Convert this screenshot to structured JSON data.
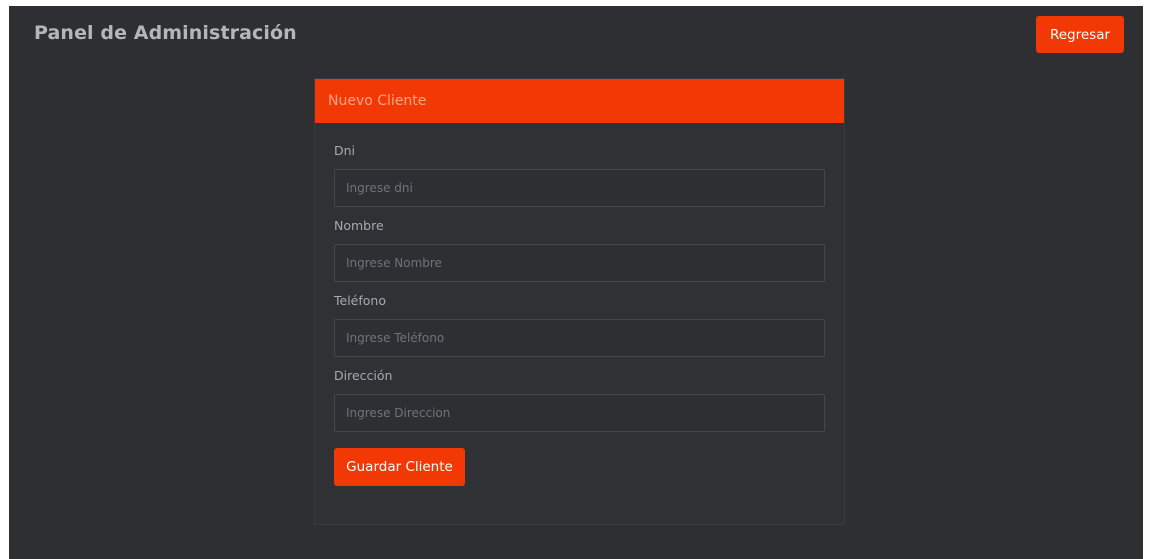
{
  "header": {
    "title": "Panel de Administración",
    "back_label": "Regresar"
  },
  "card": {
    "title": "Nuevo Cliente",
    "fields": [
      {
        "label": "Dni",
        "placeholder": "Ingrese dni",
        "value": ""
      },
      {
        "label": "Nombre",
        "placeholder": "Ingrese Nombre",
        "value": ""
      },
      {
        "label": "Teléfono",
        "placeholder": "Ingrese Teléfono",
        "value": ""
      },
      {
        "label": "Dirección",
        "placeholder": "Ingrese Direccion",
        "value": ""
      }
    ],
    "submit_label": "Guardar Cliente"
  },
  "colors": {
    "accent": "#f23805",
    "background": "#2d2f33",
    "card": "#2f3135"
  }
}
